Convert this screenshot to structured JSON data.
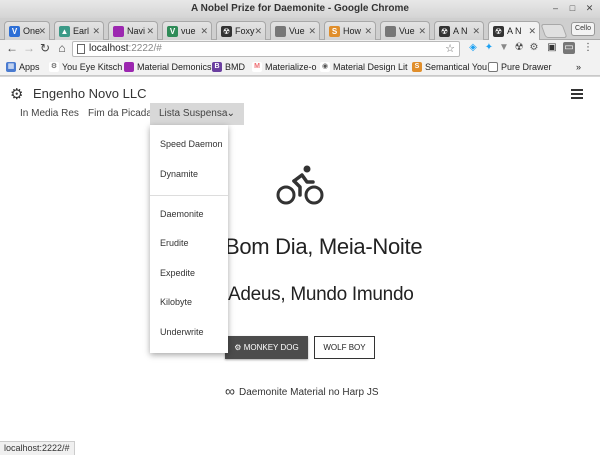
{
  "window": {
    "title": "A Nobel Prize for Daemonite - Google Chrome"
  },
  "tabs": [
    {
      "label": "One",
      "icon": "v-favicon",
      "color": "#2d6fd6",
      "glyph": "V"
    },
    {
      "label": "Earl",
      "icon": "triangle-favicon",
      "color": "#3b9a87",
      "glyph": "▲"
    },
    {
      "label": "Navi",
      "icon": "square-favicon",
      "color": "#9c27b0",
      "glyph": ""
    },
    {
      "label": "vue",
      "icon": "v-favicon",
      "color": "#2e8b57",
      "glyph": "V"
    },
    {
      "label": "Foxy",
      "icon": "hazard-favicon",
      "color": "#333333",
      "glyph": "☢"
    },
    {
      "label": "Vue",
      "icon": "doc-favicon",
      "color": "#777777",
      "glyph": ""
    },
    {
      "label": "How",
      "icon": "stackoverflow-favicon",
      "color": "#e08e2b",
      "glyph": "S"
    },
    {
      "label": "Vue",
      "icon": "doc-favicon",
      "color": "#777777",
      "glyph": ""
    },
    {
      "label": "A N",
      "icon": "hazard-favicon",
      "color": "#333333",
      "glyph": "☢"
    },
    {
      "label": "A N",
      "icon": "hazard-favicon",
      "color": "#333333",
      "glyph": "☢",
      "active": true
    }
  ],
  "profile": "Cello",
  "address": {
    "host": "localhost",
    "path": ":2222/#"
  },
  "bookmarks": [
    {
      "label": "Apps",
      "icon": "apps-grid-icon",
      "color": "#4a7bd0",
      "glyph": "▦"
    },
    {
      "label": "You Eye Kitsch",
      "icon": "gear-icon",
      "color": "#444444",
      "glyph": "⚙"
    },
    {
      "label": "Material Demonics",
      "icon": "square-favicon",
      "color": "#9c27b0",
      "glyph": ""
    },
    {
      "label": "BMD",
      "icon": "b-favicon",
      "color": "#6b3fa0",
      "glyph": "B"
    },
    {
      "label": "Materialize-o",
      "icon": "m-favicon",
      "color": "#ee6e73",
      "glyph": "M"
    },
    {
      "label": "Material Design Lit",
      "icon": "globe-icon",
      "color": "#555555",
      "glyph": "◉"
    },
    {
      "label": "Semantical You",
      "icon": "s-favicon",
      "color": "#e08e2b",
      "glyph": "S"
    },
    {
      "label": "Pure Drawer",
      "icon": "doc-favicon",
      "color": "#777777",
      "glyph": ""
    }
  ],
  "bookmarks_more": "»",
  "site": {
    "brand": "Engenho Novo LLC",
    "nav": [
      "In Media Res",
      "Fim da Picada"
    ],
    "dropdown": {
      "label": "Lista Suspensa",
      "group1": [
        "Speed Daemon",
        "Dynamite"
      ],
      "group2": [
        "Daemonite",
        "Erudite",
        "Expedite",
        "Kilobyte",
        "Underwrite"
      ]
    },
    "hero_title": "Bom Dia, Meia-Noite",
    "hero_subtitle": "Adeus, Mundo Imundo",
    "btn_primary": "MONKEY DOG",
    "btn_secondary": "WOLF BOY",
    "footer": "Daemonite Material no Harp JS"
  },
  "status_url": "localhost:2222/#"
}
